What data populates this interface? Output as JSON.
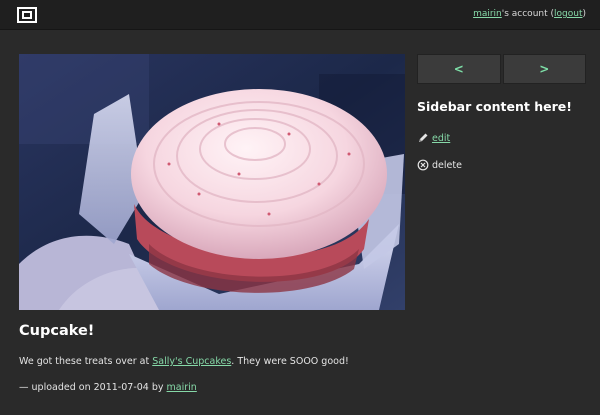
{
  "header": {
    "logo_icon": "square-frame-icon",
    "account": {
      "username": "mairin",
      "suffix": "'s account (",
      "logout_label": "logout",
      "close_paren": ")"
    }
  },
  "photo": {
    "subject": "cupcake"
  },
  "sidebar": {
    "prev_label": "<",
    "next_label": ">",
    "title": "Sidebar content here!",
    "edit_label": "edit",
    "delete_label": "delete",
    "edit_icon": "pencil-icon",
    "delete_icon": "circle-x-icon"
  },
  "post": {
    "title": "Cupcake!",
    "description_before": "We got these treats over at ",
    "description_link": "Sally's Cupcakes",
    "description_after": ". They were SOOO good!",
    "meta_prefix": "— uploaded on ",
    "date": "2011-07-04",
    "meta_by": " by ",
    "author": "mairin"
  },
  "colors": {
    "background": "#2a2a2a",
    "topbar": "#1f1f1f",
    "link": "#86d9a8",
    "pager_arrow": "#7ee0a8"
  }
}
